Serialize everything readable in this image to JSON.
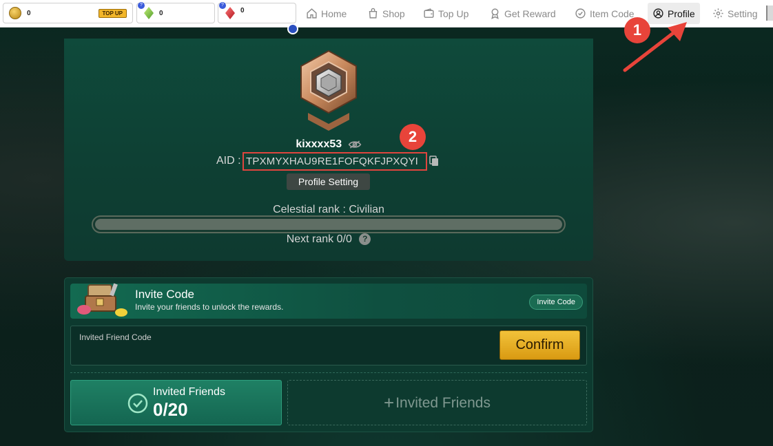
{
  "wallet": {
    "coins": "0",
    "topup_label": "TOP UP",
    "green_gems": "0",
    "red_gems": "0",
    "badge": "?"
  },
  "nav": {
    "items": [
      {
        "label": "Home",
        "icon": "home-icon"
      },
      {
        "label": "Shop",
        "icon": "shop-icon"
      },
      {
        "label": "Top Up",
        "icon": "wallet-icon"
      },
      {
        "label": "Get Reward",
        "icon": "reward-icon"
      },
      {
        "label": "Item Code",
        "icon": "check-circle-icon"
      },
      {
        "label": "Profile",
        "icon": "user-icon",
        "active": true
      },
      {
        "label": "Setting",
        "icon": "gear-icon"
      }
    ]
  },
  "annotations": {
    "marker_1": "1",
    "marker_2": "2",
    "color": "#e8443a"
  },
  "profile": {
    "username": "kixxxx53",
    "aid_label": "AID :",
    "aid_value": "TPXMYXHAU9RE1FOFQKFJPXQYI",
    "profile_setting_label": "Profile Setting",
    "rank_label": "Celestial rank : Civilian",
    "rank_progress": 0,
    "next_rank_label": "Next rank 0/0",
    "help": "?"
  },
  "invite": {
    "title": "Invite Code",
    "subtitle": "Invite your friends to unlock the rewards.",
    "code_button": "Invite Code",
    "field_label": "Invited Friend Code",
    "field_value": "",
    "confirm_label": "Confirm",
    "friends_label": "Invited Friends",
    "friends_value": "0/20",
    "add_friends_label": "Invited Friends"
  },
  "colors": {
    "accent_gold": "#f2b62a",
    "panel_green": "#0f4a3b",
    "highlight_red": "#e0453e"
  }
}
